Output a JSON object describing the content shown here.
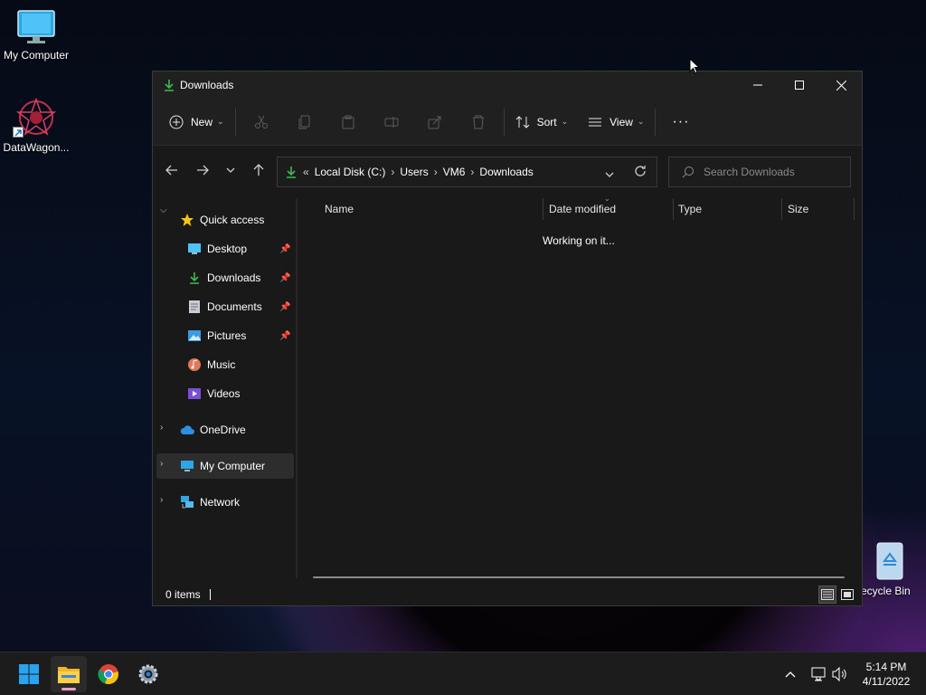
{
  "desktop": {
    "icons": [
      {
        "label": "My Computer",
        "icon": "monitor-icon"
      },
      {
        "label": "DataWagon...",
        "icon": "datawagon-icon"
      },
      {
        "label": "ecycle Bin",
        "icon": "recycle-bin-icon"
      }
    ]
  },
  "window": {
    "title": "Downloads",
    "controls": {
      "minimize": "—",
      "maximize": "☐",
      "close": "✕"
    },
    "toolbar": {
      "new_label": "New",
      "sort_label": "Sort",
      "view_label": "View",
      "more_label": "···",
      "disabled_icons": [
        "cut-icon",
        "copy-icon",
        "paste-icon",
        "rename-icon",
        "share-icon",
        "delete-icon"
      ]
    },
    "address": {
      "prefix": "«",
      "crumbs": [
        "Local Disk (C:)",
        "Users",
        "VM6",
        "Downloads"
      ],
      "search_placeholder": "Search Downloads"
    },
    "nav": {
      "quick_access": "Quick access",
      "items": [
        {
          "label": "Desktop",
          "icon": "desktop-icon",
          "pinned": true
        },
        {
          "label": "Downloads",
          "icon": "download-icon",
          "pinned": true
        },
        {
          "label": "Documents",
          "icon": "documents-icon",
          "pinned": true
        },
        {
          "label": "Pictures",
          "icon": "pictures-icon",
          "pinned": true
        },
        {
          "label": "Music",
          "icon": "music-icon",
          "pinned": false
        },
        {
          "label": "Videos",
          "icon": "videos-icon",
          "pinned": false
        }
      ],
      "onedrive": "OneDrive",
      "my_computer": "My Computer",
      "network": "Network"
    },
    "columns": [
      "Name",
      "Date modified",
      "Type",
      "Size"
    ],
    "working_text": "Working on it...",
    "status": "0 items"
  },
  "taskbar": {
    "apps": [
      "start-icon",
      "file-explorer-icon",
      "chrome-icon",
      "settings-icon"
    ],
    "time": "5:14 PM",
    "date": "4/11/2022"
  },
  "colors": {
    "accent_download": "#3fb950",
    "window_bg": "#191919",
    "titlebar_bg": "#202020",
    "taskbar_bg": "#1c1c1c"
  }
}
